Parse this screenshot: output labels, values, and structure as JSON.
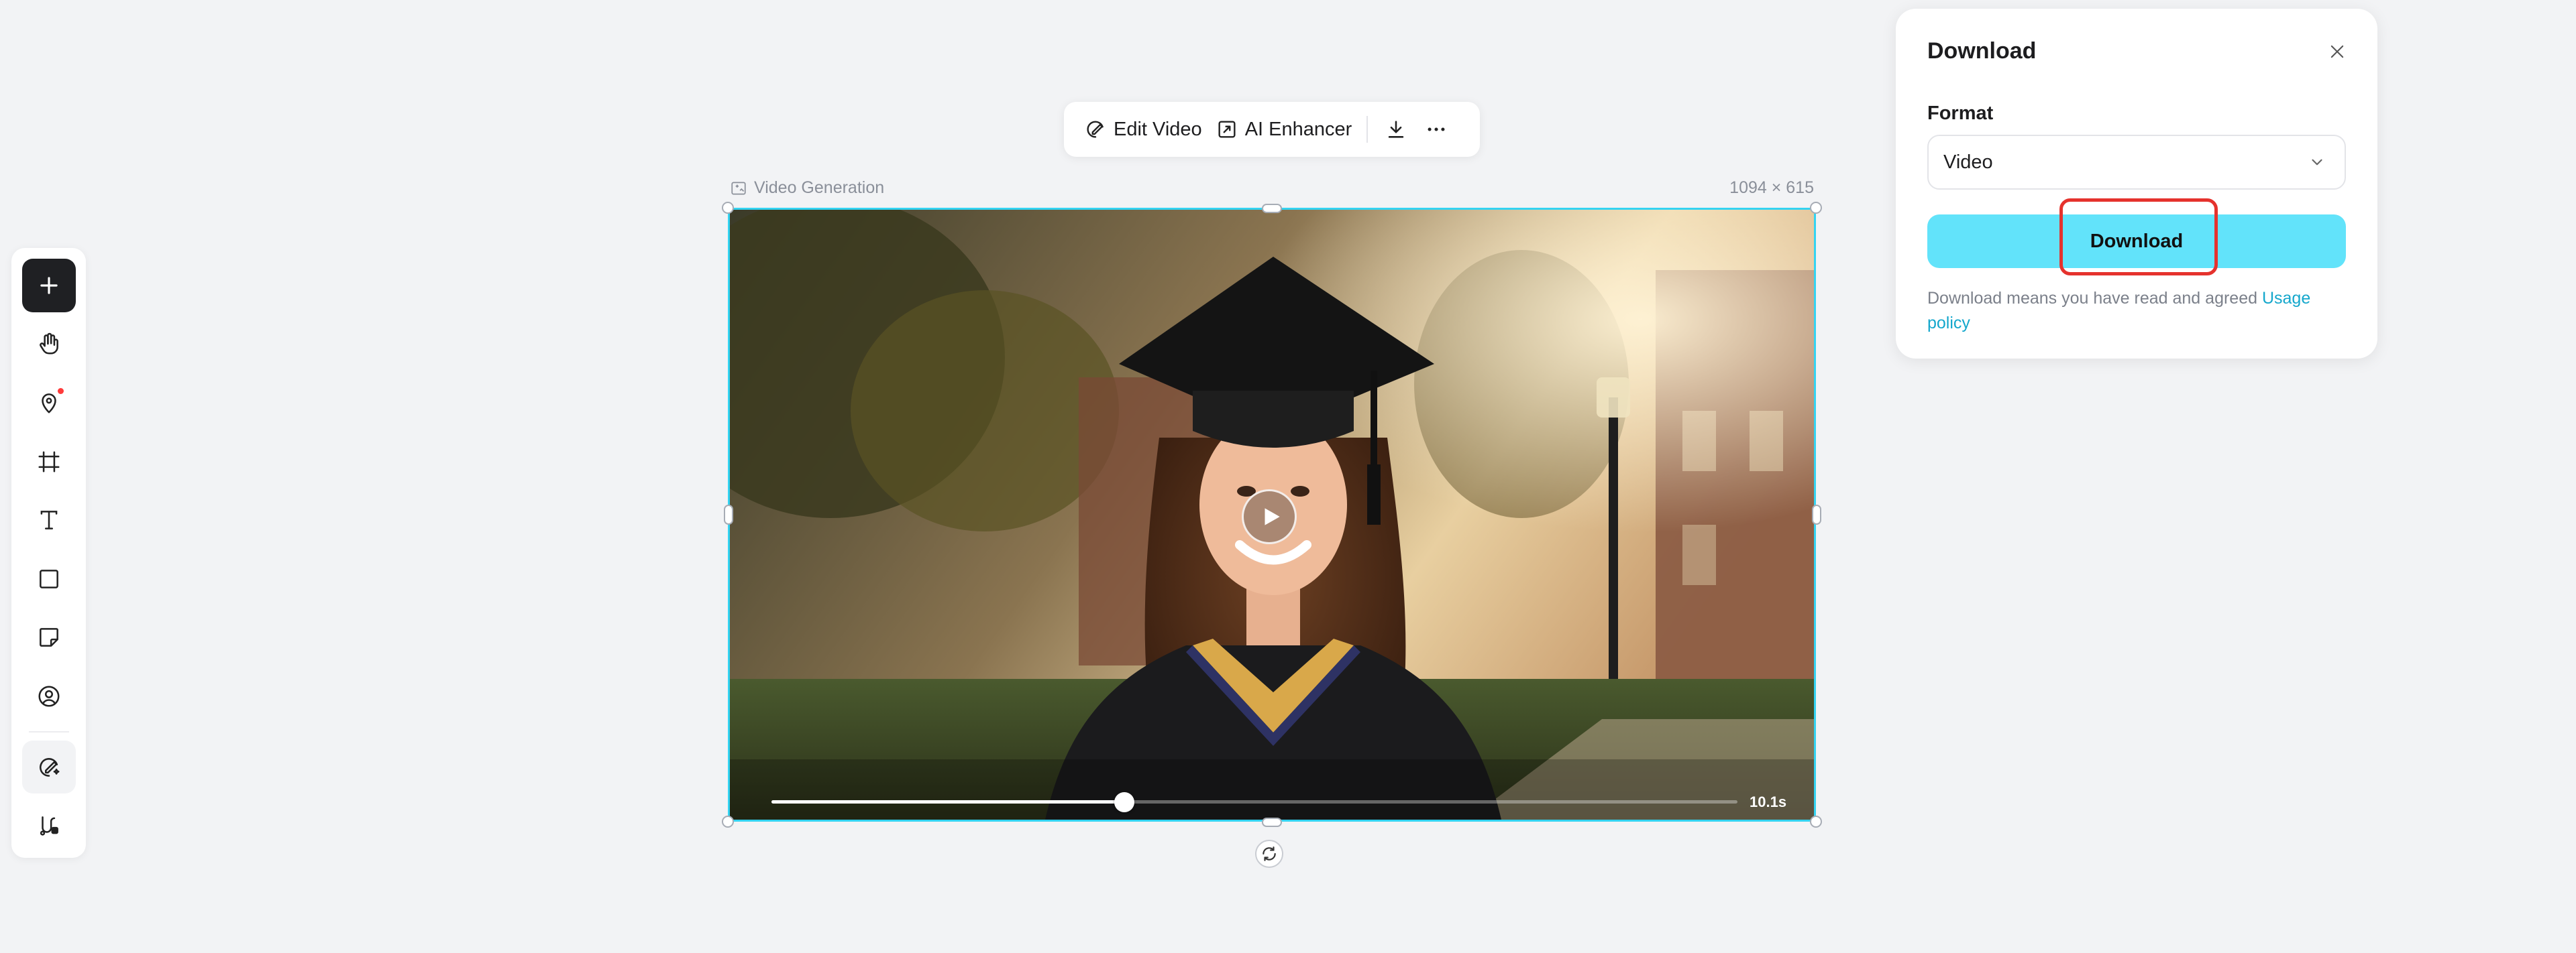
{
  "toolbar": {
    "items": [
      {
        "name": "add",
        "icon": "plus-icon"
      },
      {
        "name": "hand",
        "icon": "hand-icon"
      },
      {
        "name": "location",
        "icon": "map-pin-icon"
      },
      {
        "name": "frame",
        "icon": "crop-frame-icon"
      },
      {
        "name": "text",
        "icon": "text-icon"
      },
      {
        "name": "shape",
        "icon": "square-icon"
      },
      {
        "name": "sticky-note",
        "icon": "sticky-note-icon"
      },
      {
        "name": "avatar",
        "icon": "user-circle-icon"
      },
      {
        "name": "magic-edit",
        "icon": "magic-edit-icon"
      },
      {
        "name": "flow",
        "icon": "flow-icon"
      }
    ]
  },
  "actionbar": {
    "edit_video": "Edit Video",
    "ai_enhancer": "AI Enhancer"
  },
  "canvas": {
    "label": "Video Generation",
    "size": "1094 × 615"
  },
  "video": {
    "progress": 0.365,
    "duration": "10.1s"
  },
  "download_panel": {
    "title": "Download",
    "format_label": "Format",
    "format_value": "Video",
    "download_button": "Download",
    "policy_text": "Download means you have read and agreed ",
    "policy_link": "Usage policy"
  },
  "colors": {
    "accent": "#62e3fa",
    "selection": "#34d3f1",
    "highlight": "#e5322d",
    "link": "#14a7cc"
  }
}
